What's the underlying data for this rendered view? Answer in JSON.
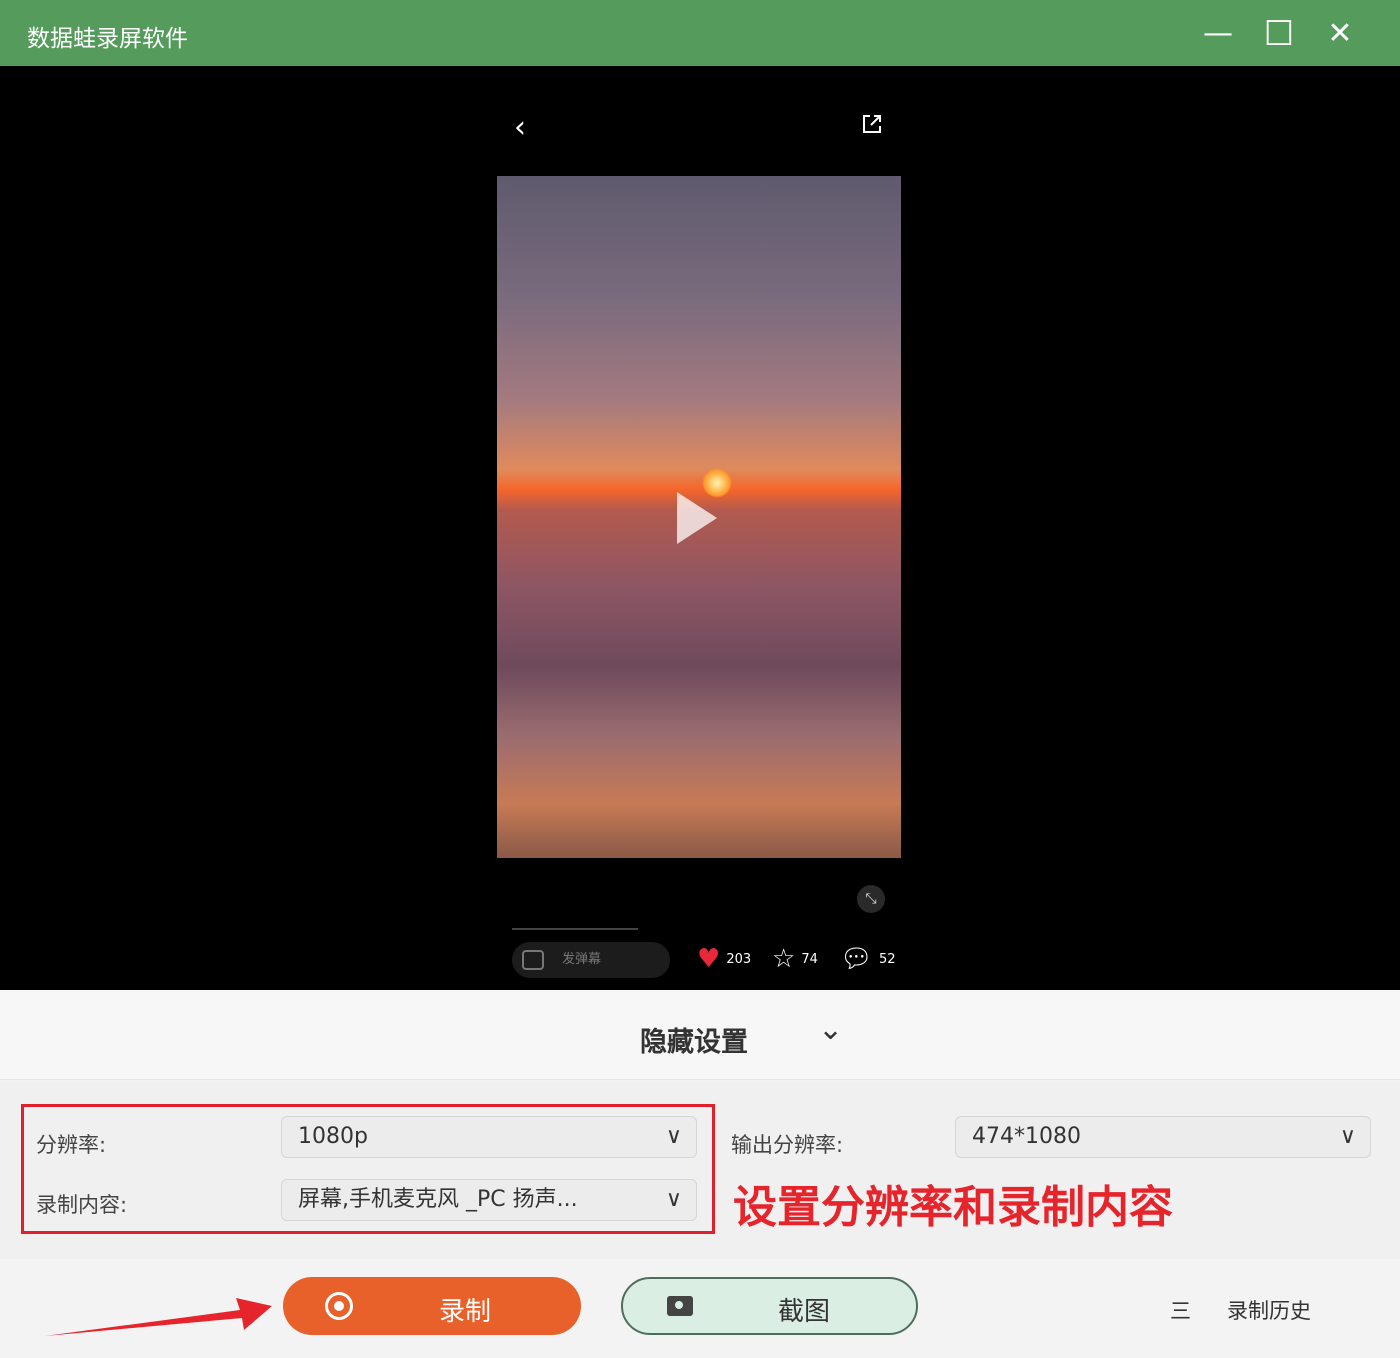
{
  "window": {
    "title": "数据蛙录屏软件",
    "minimize": "—",
    "maximize": "☐",
    "close": "✕"
  },
  "preview": {
    "back": "‹",
    "danmu_label": "发弹幕",
    "likes": "203",
    "favorites": "74",
    "comments": "52"
  },
  "hide_settings": {
    "label": "隐藏设置",
    "chevron": "⌄"
  },
  "settings": {
    "resolution_label": "分辨率:",
    "resolution_value": "1080p",
    "content_label": "录制内容:",
    "content_value": "屏幕,手机麦克风 _PC 扬声...",
    "output_label": "输出分辨率:",
    "output_value": "474*1080",
    "annotation": "设置分辨率和录制内容"
  },
  "actions": {
    "record": "录制",
    "screenshot": "截图",
    "history_icon": "三",
    "history": "录制历史"
  },
  "colors": {
    "titlebar": "#559b5c",
    "record": "#e8612a",
    "annotation": "#e6242c"
  }
}
